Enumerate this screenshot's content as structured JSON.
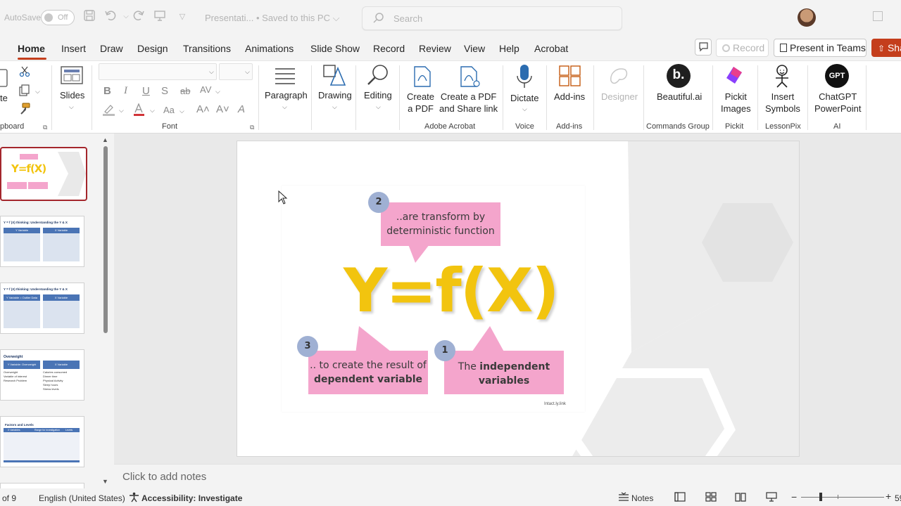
{
  "titlebar": {
    "autosave_label": "AutoSave",
    "autosave_state": "Off",
    "document_title": "Presentati... • Saved to this PC ⌵",
    "search_placeholder": "Search"
  },
  "tabs": [
    "Home",
    "Insert",
    "Draw",
    "Design",
    "Transitions",
    "Animations",
    "Slide Show",
    "Record",
    "Review",
    "View",
    "Help",
    "Acrobat"
  ],
  "active_tab": "Home",
  "right_buttons": {
    "record": "Record",
    "teams": "Present in Teams",
    "share": "Sha"
  },
  "accent_color": "#c43e1c",
  "ribbon": {
    "clipboard": {
      "paste_label": "te",
      "group": "pboard"
    },
    "slides": {
      "label": "Slides"
    },
    "font": {
      "group": "Font",
      "bold": "B",
      "italic": "I",
      "underline": "U",
      "shadow": "S",
      "strike": "ab",
      "spacing": "AV",
      "aa": "Aa",
      "grow": "A˄",
      "shrink": "A˅",
      "clear": "A"
    },
    "paragraph": "Paragraph",
    "drawing": "Drawing",
    "editing": "Editing",
    "acrobat": {
      "create_pdf_1": "Create",
      "create_pdf_2": "a PDF",
      "share_1": "Create a PDF",
      "share_2": "and Share link",
      "group": "Adobe Acrobat"
    },
    "voice": {
      "dictate": "Dictate",
      "group": "Voice"
    },
    "addins": {
      "label": "Add-ins",
      "group": "Add-ins"
    },
    "designer": "Designer",
    "beautiful": {
      "label": "Beautiful.ai",
      "group": "Commands Group",
      "logo": "b."
    },
    "pickit": {
      "line1": "Pickit",
      "line2": "Images",
      "group": "Pickit"
    },
    "symbols": {
      "line1": "Insert",
      "line2": "Symbols",
      "group": "LessonPix"
    },
    "chatgpt": {
      "line1": "ChatGPT",
      "line2": "PowerPoint",
      "group": "AI",
      "logo": "GPT"
    }
  },
  "thumbnails": [
    {
      "title": "Y=f(X)",
      "selected": true
    },
    {
      "title": "Y = f (X) thinking: Understanding the Y & X",
      "left_head": "Y Variable",
      "right_head": "X Variable"
    },
    {
      "title": "Y = f (X) thinking: Understanding the Y & X",
      "left_head": "Y Variable = Outlier Data",
      "right_head": "X Variable"
    },
    {
      "title": "Overweight",
      "left_head": "Y Variable: Overweight",
      "right_head": "X Variable",
      "left_items": [
        "Overweight",
        "Variable of interest",
        "Research Problem"
      ],
      "right_items": [
        "Calories consumed",
        "Dinner time",
        "Physical Activity",
        "Sleep hours",
        "Stress levels"
      ]
    },
    {
      "title": "Factors and Levels",
      "cols": [
        "X Variables",
        "Range for investigation",
        "Levels"
      ]
    }
  ],
  "slide": {
    "formula": "Y=f(X)",
    "box2_badge": "2",
    "box2_line1": "..are transform by",
    "box2_line2": "deterministic function",
    "box3_badge": "3",
    "box3_line1": ".. to create the result of",
    "box3_line2": "dependent variable",
    "box1_badge": "1",
    "box1_line1_plain": "The ",
    "box1_line1_bold": "independent",
    "box1_line2": "variables",
    "watermark": "Intact.ly.link"
  },
  "notes_placeholder": "Click to add notes",
  "status": {
    "slide_count": "of 9",
    "language": "English (United States)",
    "accessibility": "Accessibility: Investigate",
    "notes": "Notes",
    "zoom": "59"
  }
}
